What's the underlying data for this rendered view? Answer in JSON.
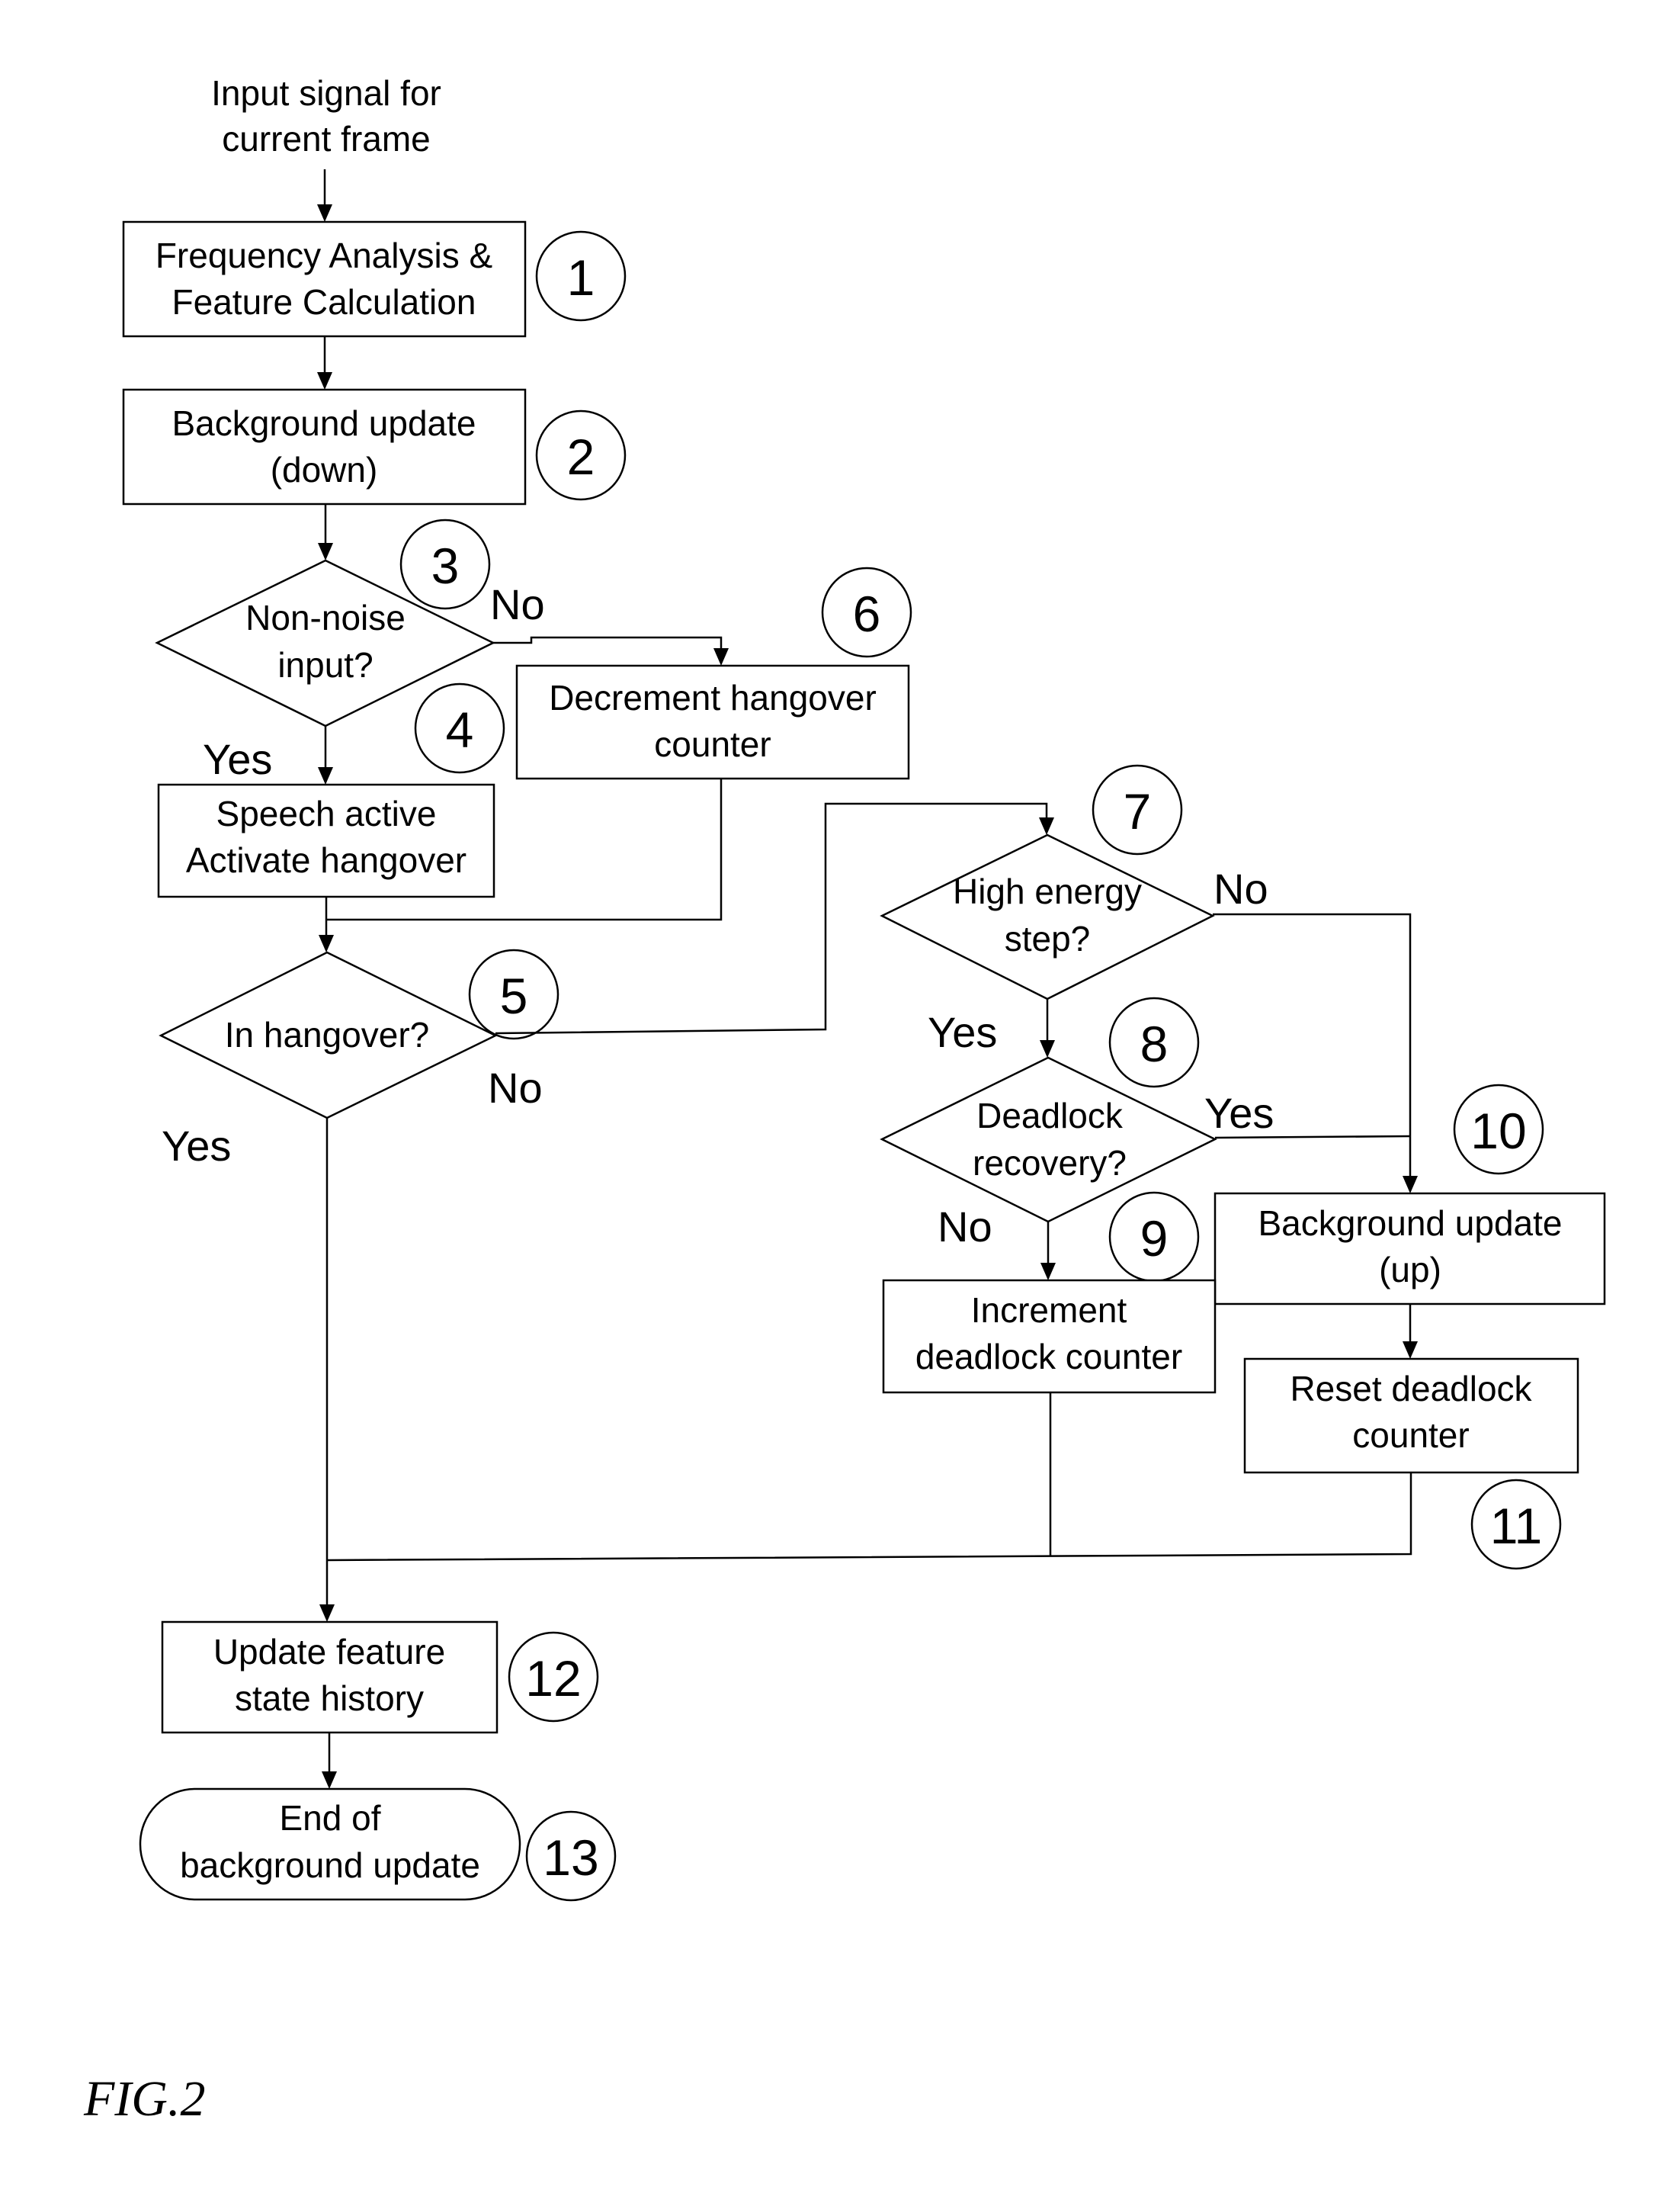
{
  "figure": {
    "caption": "FIG.2",
    "input": {
      "line1": "Input signal for",
      "line2": "current frame"
    },
    "steps": {
      "s1": {
        "number": "1",
        "line1": "Frequency Analysis &",
        "line2": "Feature Calculation"
      },
      "s2": {
        "number": "2",
        "line1": "Background update",
        "line2": "(down)"
      },
      "s3": {
        "number": "3",
        "line1": "Non-noise",
        "line2": "input?"
      },
      "s4": {
        "number": "4",
        "line1": "Speech active",
        "line2": "Activate hangover"
      },
      "s5": {
        "number": "5",
        "line1": "In hangover?"
      },
      "s6": {
        "number": "6",
        "line1": "Decrement hangover",
        "line2": "counter"
      },
      "s7": {
        "number": "7",
        "line1": "High energy",
        "line2": "step?"
      },
      "s8": {
        "number": "8",
        "line1": "Deadlock",
        "line2": "recovery?"
      },
      "s9": {
        "number": "9",
        "line1": "Increment",
        "line2": "deadlock counter"
      },
      "s10": {
        "number": "10",
        "line1": "Background update",
        "line2": "(up)"
      },
      "s11": {
        "number": "11",
        "line1": "Reset deadlock",
        "line2": "counter"
      },
      "s12": {
        "number": "12",
        "line1": "Update feature",
        "line2": "state history"
      },
      "s13": {
        "number": "13",
        "line1": "End of",
        "line2": "background update"
      }
    },
    "branch_labels": {
      "s3_no": "No",
      "s3_yes": "Yes",
      "s5_no": "No",
      "s5_yes": "Yes",
      "s7_no": "No",
      "s7_yes": "Yes",
      "s8_yes": "Yes",
      "s8_no": "No"
    }
  }
}
